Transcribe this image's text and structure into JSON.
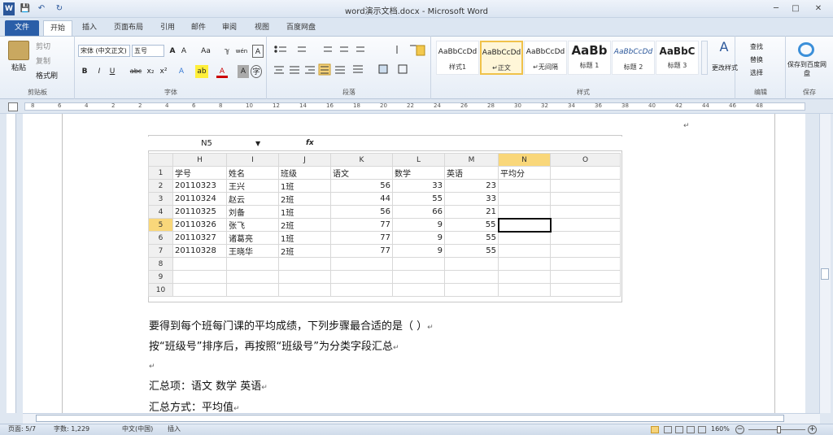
{
  "window": {
    "title": "word演示文档.docx - Microsoft Word",
    "app_icon": "W"
  },
  "quick_access": {
    "save": "💾",
    "undo": "↶",
    "redo": "↻"
  },
  "window_controls": {
    "minimize": "─",
    "maximize": "□",
    "close": "✕"
  },
  "tabs": [
    "文件",
    "开始",
    "插入",
    "页面布局",
    "引用",
    "邮件",
    "审阅",
    "视图",
    "百度网盘"
  ],
  "ribbon": {
    "clipboard": {
      "paste": "粘贴",
      "cut": "剪切",
      "copy": "复制",
      "format_painter": "格式刷",
      "label": "剪贴板"
    },
    "font": {
      "font_name": "宋体 (中文正文)",
      "font_size": "五号",
      "grow": "A",
      "shrink": "A",
      "case": "Aa",
      "clear": "ℽ",
      "phonetic": "wén",
      "border_char": "A",
      "bold": "B",
      "italic": "I",
      "underline": "U",
      "strike": "abc",
      "sub": "x₂",
      "sup": "x²",
      "effects": "A",
      "highlight": "ab",
      "font_color": "A",
      "shading": "A",
      "circle": "字",
      "label": "字体"
    },
    "paragraph": {
      "label": "段落"
    },
    "styles": {
      "items": [
        {
          "preview": "AaBbCcDd",
          "name": "样式1"
        },
        {
          "preview": "AaBbCcDd",
          "name": "↵正文"
        },
        {
          "preview": "AaBbCcDd",
          "name": "↵无间隔"
        },
        {
          "preview": "AaBb",
          "name": "标题 1"
        },
        {
          "preview": "AaBbCcDd",
          "name": "标题 2"
        },
        {
          "preview": "AaBbC",
          "name": "标题 3"
        }
      ],
      "change": "更改样式",
      "label": "样式"
    },
    "editing": {
      "find": "查找",
      "replace": "替换",
      "select": "选择",
      "label": "编辑"
    },
    "save": {
      "save_baidu": "保存到百度网盘",
      "label": "保存"
    }
  },
  "ruler": {
    "marks": [
      "8",
      "6",
      "4",
      "2",
      "2",
      "4",
      "6",
      "8",
      "10",
      "12",
      "14",
      "16",
      "18",
      "20",
      "22",
      "24",
      "26",
      "28",
      "30",
      "32",
      "34",
      "36",
      "38",
      "40",
      "42",
      "44",
      "46",
      "48"
    ]
  },
  "excel": {
    "name_box": "N5",
    "fx": "fx",
    "columns": [
      "",
      "H",
      "I",
      "J",
      "K",
      "L",
      "M",
      "N",
      "O"
    ],
    "rows": [
      {
        "n": "1",
        "c": [
          "学号",
          "姓名",
          "班级",
          "语文",
          "数学",
          "英语",
          "平均分",
          ""
        ]
      },
      {
        "n": "2",
        "c": [
          "20110323",
          "王兴",
          "1班",
          "56",
          "33",
          "23",
          "",
          ""
        ]
      },
      {
        "n": "3",
        "c": [
          "20110324",
          "赵云",
          "2班",
          "44",
          "55",
          "33",
          "",
          ""
        ]
      },
      {
        "n": "4",
        "c": [
          "20110325",
          "刘备",
          "1班",
          "56",
          "66",
          "21",
          "",
          ""
        ]
      },
      {
        "n": "5",
        "c": [
          "20110326",
          "张飞",
          "2班",
          "77",
          "9",
          "55",
          "",
          ""
        ]
      },
      {
        "n": "6",
        "c": [
          "20110327",
          "诸葛亮",
          "1班",
          "77",
          "9",
          "55",
          "",
          ""
        ]
      },
      {
        "n": "7",
        "c": [
          "20110328",
          "王晓华",
          "2班",
          "77",
          "9",
          "55",
          "",
          ""
        ]
      },
      {
        "n": "8",
        "c": [
          "",
          "",
          "",
          "",
          "",
          "",
          "",
          ""
        ]
      },
      {
        "n": "9",
        "c": [
          "",
          "",
          "",
          "",
          "",
          "",
          "",
          ""
        ]
      },
      {
        "n": "10",
        "c": [
          "",
          "",
          "",
          "",
          "",
          "",
          "",
          ""
        ]
      }
    ]
  },
  "document": {
    "line1": "要得到每个班每门课的平均成绩，下列步骤最合适的是（ ）",
    "line2": "按“班级号”排序后，再按照“班级号”为分类字段汇总",
    "line3": "",
    "line4": "汇总项：语文 数学 英语",
    "line5": "汇总方式：平均值",
    "para_mark": "↵"
  },
  "status": {
    "page": "页面: 5/7",
    "words": "字数: 1,229",
    "lang": "中文(中国)",
    "mode": "插入",
    "zoom": "160%"
  }
}
